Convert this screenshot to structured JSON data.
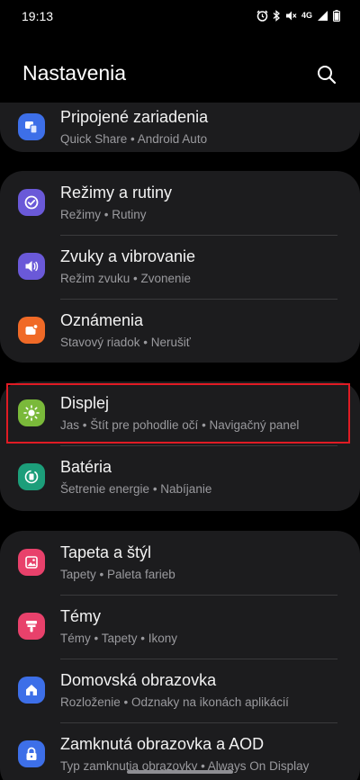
{
  "status": {
    "time": "19:13",
    "network": "4G"
  },
  "header": {
    "title": "Nastavenia"
  },
  "cards": [
    {
      "items": [
        {
          "title": "Pripojené zariadenia",
          "subtitle": "Quick Share  •  Android Auto",
          "icon": "connected-devices-icon",
          "color": "#3d6fe8"
        }
      ]
    },
    {
      "items": [
        {
          "title": "Režimy a rutiny",
          "subtitle": "Režimy  •  Rutiny",
          "icon": "modes-routines-icon",
          "color": "#6a59d8"
        },
        {
          "title": "Zvuky a vibrovanie",
          "subtitle": "Režim zvuku  •  Zvonenie",
          "icon": "sound-icon",
          "color": "#6a59d8"
        },
        {
          "title": "Oznámenia",
          "subtitle": "Stavový riadok  •  Nerušiť",
          "icon": "notifications-icon",
          "color": "#f06a27"
        }
      ]
    },
    {
      "items": [
        {
          "title": "Displej",
          "subtitle": "Jas  •  Štít pre pohodlie očí  •  Navigačný panel",
          "icon": "display-icon",
          "color": "#7ab93a"
        },
        {
          "title": "Batéria",
          "subtitle": "Šetrenie energie  •  Nabíjanie",
          "icon": "battery-icon",
          "color": "#1c9e7a"
        }
      ]
    },
    {
      "items": [
        {
          "title": "Tapeta a štýl",
          "subtitle": "Tapety  •  Paleta farieb",
          "icon": "wallpaper-icon",
          "color": "#e8416b"
        },
        {
          "title": "Témy",
          "subtitle": "Témy  •  Tapety  •  Ikony",
          "icon": "themes-icon",
          "color": "#e8416b"
        },
        {
          "title": "Domovská obrazovka",
          "subtitle": "Rozloženie  •  Odznaky na ikonách aplikácií",
          "icon": "home-screen-icon",
          "color": "#3d6fe8"
        },
        {
          "title": "Zamknutá obrazovka a AOD",
          "subtitle": "Typ zamknutia obrazovky  •  Always On Display",
          "icon": "lock-screen-icon",
          "color": "#3d6fe8"
        }
      ]
    }
  ]
}
